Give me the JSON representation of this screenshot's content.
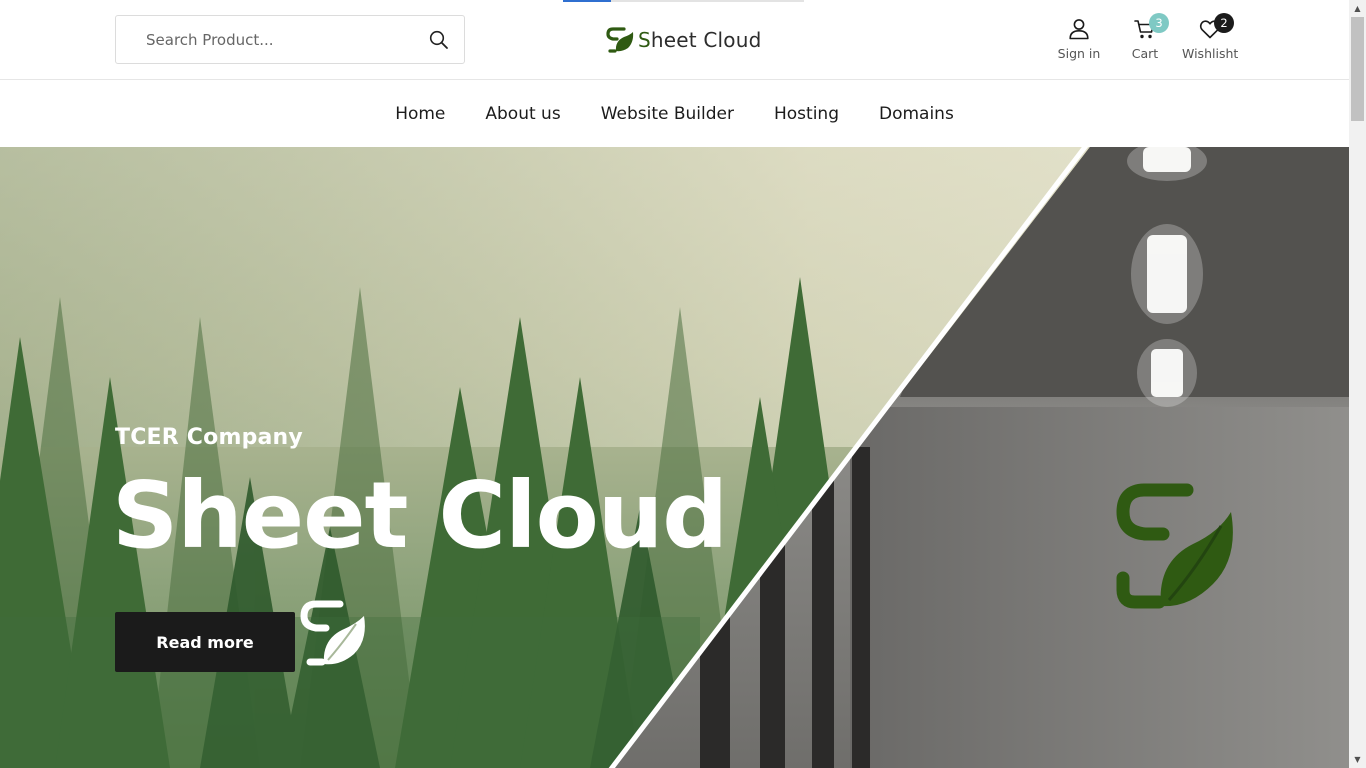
{
  "header": {
    "search": {
      "placeholder": "Search Product...",
      "icon": "search-icon"
    },
    "logo": {
      "text_green": "S",
      "text_rest": "heet Cloud"
    },
    "page_progress": 0.2,
    "actions": {
      "sign_in": {
        "label": "Sign in",
        "icon": "user-icon"
      },
      "cart": {
        "label": "Cart",
        "icon": "cart-icon",
        "count": "3"
      },
      "wishlist": {
        "label": "Wishlisht",
        "icon": "heart-icon",
        "count": "2"
      }
    }
  },
  "nav": {
    "items": [
      {
        "label": "Home"
      },
      {
        "label": "About us"
      },
      {
        "label": "Website Builder"
      },
      {
        "label": "Hosting"
      },
      {
        "label": "Domains"
      }
    ]
  },
  "hero": {
    "subtitle": "TCER Company",
    "title": "Sheet Cloud",
    "button_label": "Read more",
    "brand_mark": "leaf-s-logo-icon"
  },
  "colors": {
    "brand_green": "#2f5a12",
    "cart_badge": "#7fc9c4",
    "wishlist_badge": "#1b1b1b",
    "button_dark": "#1b1b1b",
    "progress_blue": "#2f6fd0"
  }
}
